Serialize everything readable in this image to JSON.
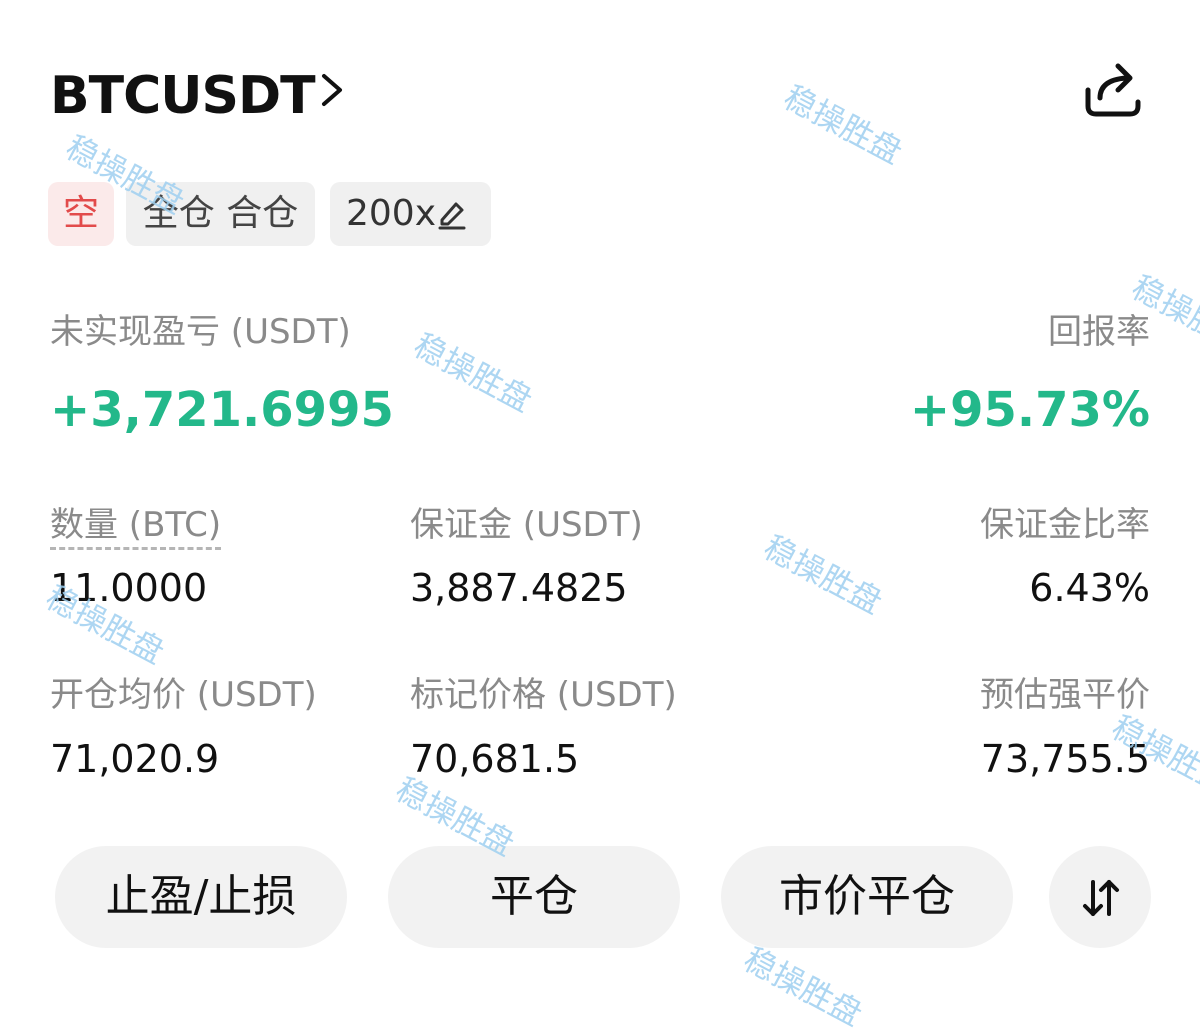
{
  "header": {
    "symbol": "BTCUSDT"
  },
  "tags": {
    "side": "空",
    "margin_mode": "全仓 合仓",
    "leverage": "200x"
  },
  "pnl": {
    "label": "未实现盈亏 (USDT)",
    "value": "+3,721.6995",
    "roe_label": "回报率",
    "roe_value": "+95.73%"
  },
  "stats": {
    "qty_label": "数量 (BTC)",
    "qty_value": "11.0000",
    "margin_label": "保证金 (USDT)",
    "margin_value": "3,887.4825",
    "margin_ratio_label": "保证金比率",
    "margin_ratio_value": "6.43%",
    "entry_label": "开仓均价 (USDT)",
    "entry_value": "71,020.9",
    "mark_label": "标记价格 (USDT)",
    "mark_value": "70,681.5",
    "liq_label": "预估强平价",
    "liq_value": "73,755.5"
  },
  "actions": {
    "tpsl": "止盈/止损",
    "close": "平仓",
    "market_close": "市价平仓"
  },
  "watermark": "稳操胜盘",
  "colors": {
    "positive": "#23b88a",
    "short_tag_bg": "#fbeaea",
    "short_tag_text": "#e24b4b",
    "button_bg": "#f2f2f2"
  },
  "icons": {
    "chevron": "chevron-right-icon",
    "share": "share-icon",
    "edit": "edit-pencil-icon",
    "swap": "swap-arrows-icon"
  }
}
